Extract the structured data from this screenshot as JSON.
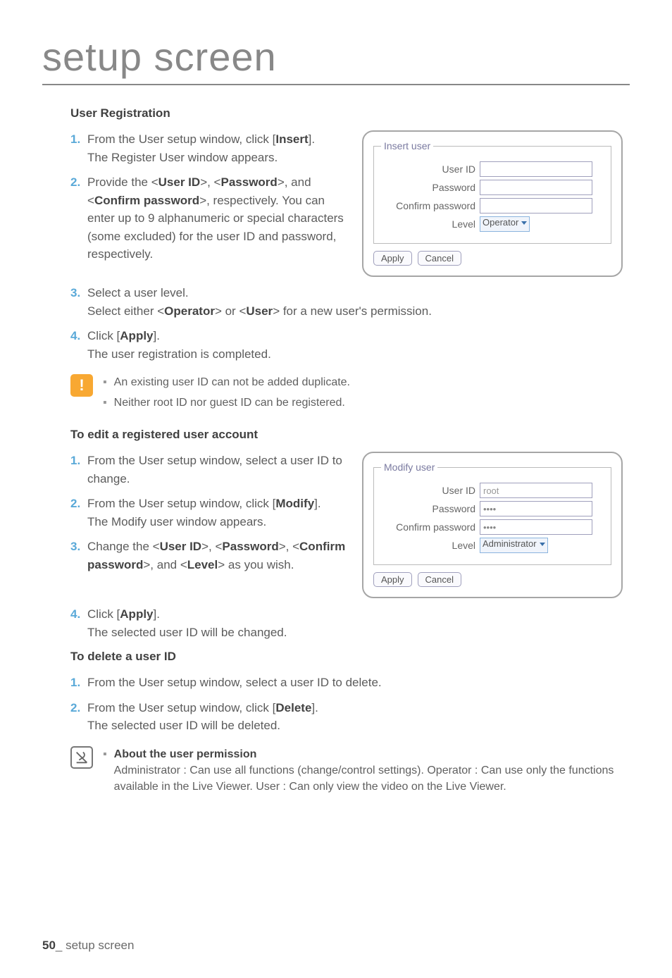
{
  "page": {
    "title": "setup screen",
    "footer_page_num": "50",
    "footer_separator": "_",
    "footer_text": "setup screen"
  },
  "section1": {
    "heading": "User Registration",
    "steps": [
      {
        "num": "1.",
        "line1_a": "From the User setup window, click [",
        "line1_bold": "Insert",
        "line1_b": "].",
        "line2": "The Register User window appears."
      },
      {
        "num": "2.",
        "line1_a": "Provide the <",
        "b1": "User ID",
        "m1": ">, <",
        "b2": "Password",
        "m2": ">, and <",
        "b3": "Confirm password",
        "m3": ">, respectively. You can enter up to 9 alphanumeric or special characters (some excluded) for the user ID and password, respectively."
      },
      {
        "num": "3.",
        "line1": "Select a user level.",
        "line2_a": "Select either <",
        "b1": "Operator",
        "m1": "> or <",
        "b2": "User",
        "m2": "> for a new user's permission."
      },
      {
        "num": "4.",
        "line1_a": "Click [",
        "b1": "Apply",
        "line1_b": "].",
        "line2": "The user registration is completed."
      }
    ]
  },
  "form1": {
    "legend": "Insert user",
    "rows": {
      "userid_label": "User ID",
      "userid_value": "",
      "password_label": "Password",
      "password_value": "",
      "confirm_label": "Confirm password",
      "confirm_value": "",
      "level_label": "Level",
      "level_value": "Operator"
    },
    "apply": "Apply",
    "cancel": "Cancel"
  },
  "notes1": [
    "An existing user ID can not be added duplicate.",
    "Neither root ID nor guest ID can be registered."
  ],
  "section2": {
    "heading": "To edit a registered user account",
    "steps": [
      {
        "num": "1.",
        "text": "From the User setup window, select a user ID to change."
      },
      {
        "num": "2.",
        "line1_a": "From the User setup window, click [",
        "b1": "Modify",
        "line1_b": "].",
        "line2": "The Modify user window appears."
      },
      {
        "num": "3.",
        "line1_a": "Change the <",
        "b1": "User ID",
        "m1": ">, <",
        "b2": "Password",
        "m2": ">, <",
        "b3": "Confirm password",
        "m3": ">, and <",
        "b4": "Level",
        "m4": "> as you wish."
      },
      {
        "num": "4.",
        "line1_a": "Click [",
        "b1": "Apply",
        "line1_b": "].",
        "line2": "The selected user ID will be changed."
      }
    ]
  },
  "form2": {
    "legend": "Modify user",
    "rows": {
      "userid_label": "User ID",
      "userid_value": "root",
      "password_label": "Password",
      "password_value": "••••",
      "confirm_label": "Confirm password",
      "confirm_value": "••••",
      "level_label": "Level",
      "level_value": "Administrator"
    },
    "apply": "Apply",
    "cancel": "Cancel"
  },
  "section3": {
    "heading": "To delete a user ID",
    "steps": [
      {
        "num": "1.",
        "text": "From the User setup window, select a user ID to delete."
      },
      {
        "num": "2.",
        "line1_a": "From the User setup window, click [",
        "b1": "Delete",
        "line1_b": "].",
        "line2": "The selected user ID will be deleted."
      }
    ]
  },
  "notes2": {
    "heading": "About the user permission",
    "lines": [
      "Administrator : Can use all functions (change/control settings).",
      "Operator : Can use only the functions available in the Live Viewer.",
      "User : Can only view the video on the Live Viewer."
    ]
  }
}
